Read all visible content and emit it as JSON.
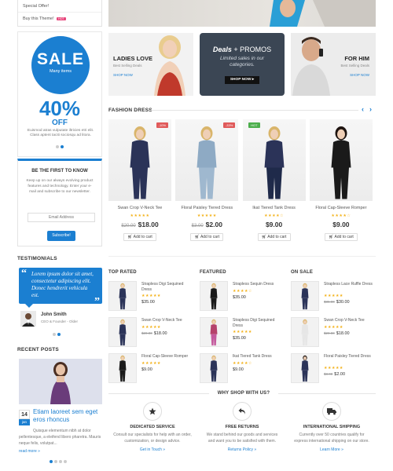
{
  "sidebar": {
    "menu": [
      {
        "label": "Special Offer!"
      },
      {
        "label": "Buy this Theme!",
        "badge": "HOT"
      }
    ],
    "sale": {
      "big": "SALE",
      "sub": "Many items",
      "percent": "40%",
      "off": "OFF",
      "text": "Euismod atras vulputate iltricies etri elit. Class aptent taciti sociosqu ad litora."
    },
    "newsletter": {
      "title": "BE THE FIRST TO KNOW",
      "text": "Keep up on our always evolving product features and technology. Enter your e-mail and subscribe to our newsletter.",
      "placeholder": "Email Address",
      "button": "Subscribe!"
    },
    "testimonials": {
      "title": "TESTIMONIALS",
      "quote": "Lorem ipsum dolor sit amet, consectetur adipiscing elit. Donec hendrerit vehicula est.",
      "name": "John Smith",
      "role": "CEO & Founder - Older"
    },
    "recent_posts": {
      "title": "RECENT POSTS",
      "day": "14",
      "month": "jan",
      "post_title": "Etiam laoreet sem eget eros rhoncus",
      "excerpt": "Quisque elementum nibh at dolor pellentesque, a eleifend libero pharetra. Mauris neque felis, volutpat...",
      "read_more": "read more »"
    }
  },
  "promos": {
    "ladies": {
      "title": "LADIES LOVE",
      "sub": "Best Selling Deals",
      "link": "SHOP NOW"
    },
    "deals": {
      "title_a": "Deals",
      "title_b": " + PROMOS",
      "text": "Limited sales in our categories.",
      "button": "SHOP NOW ▸"
    },
    "him": {
      "title": "FOR HIM",
      "sub": "Best Selling Deals",
      "link": "SHOP NOW"
    }
  },
  "fashion": {
    "title": "FASHION DRESS",
    "products": [
      {
        "name": "Swan Crop V-Neck Tee",
        "old": "$20.00",
        "price": "$18.00",
        "badge": "-10%",
        "badge_color": "#e05a5a",
        "stars": "★★★★★",
        "cart": "Add to cart"
      },
      {
        "name": "Floral Paisley Tiered Dress",
        "old": "$3.00",
        "price": "$2.00",
        "badge": "-33%",
        "badge_color": "#e05a5a",
        "stars": "★★★★★",
        "cart": "Add to cart"
      },
      {
        "name": "Ikat Tiered Tank Dress",
        "old": "",
        "price": "$9.00",
        "badge": "HOT",
        "badge_color": "#4cae4c",
        "stars": "★★★★☆",
        "cart": "Add to cart"
      },
      {
        "name": "Floral Cap-Sleeve Romper",
        "old": "",
        "price": "$9.00",
        "badge": "",
        "badge_color": "",
        "stars": "★★★★☆",
        "cart": "Add to cart"
      }
    ]
  },
  "lists": {
    "top_rated": {
      "title": "TOP RATED",
      "items": [
        {
          "name": "Strapless Digi Sequined Dress",
          "old": "",
          "price": "$35.00",
          "stars": "★★★★★"
        },
        {
          "name": "Swan Crop V-Neck Tee",
          "old": "$20.00",
          "price": "$18.00",
          "stars": "★★★★★"
        },
        {
          "name": "Floral Cap-Sleeve Romper",
          "old": "",
          "price": "$9.00",
          "stars": "★★★★★"
        }
      ]
    },
    "featured": {
      "title": "FEATURED",
      "items": [
        {
          "name": "Strapless Sequin Dress",
          "old": "",
          "price": "$35.00",
          "stars": "★★★★☆"
        },
        {
          "name": "Strapless Digi Sequined Dress",
          "old": "",
          "price": "$35.00",
          "stars": "★★★★★"
        },
        {
          "name": "Ikat Tiered Tank Dress",
          "old": "",
          "price": "$9.00",
          "stars": "★★★★☆"
        }
      ]
    },
    "on_sale": {
      "title": "ON SALE",
      "items": [
        {
          "name": "Strapless Lace Ruffle Dress",
          "old": "$35.00",
          "price": "$30.00",
          "stars": "★★★★★"
        },
        {
          "name": "Swan Crop V-Neck Tee",
          "old": "$20.00",
          "price": "$18.00",
          "stars": "★★★★★"
        },
        {
          "name": "Floral Paisley Tiered Dress",
          "old": "$3.00",
          "price": "$2.00",
          "stars": "★★★★★"
        }
      ]
    }
  },
  "why": {
    "title": "WHY SHOP WITH US?",
    "features": [
      {
        "icon": "star-icon",
        "title": "DEDICATED SERVICE",
        "text": "Consult our specialists for help with an order, customization, or design advice.",
        "link": "Get in Touch »"
      },
      {
        "icon": "return-icon",
        "title": "FREE RETURNS",
        "text": "We stand behind our goods and services and want you to be satisfied with them.",
        "link": "Returns Policy »"
      },
      {
        "icon": "truck-icon",
        "title": "INTERNATIONAL SHIPPING",
        "text": "Currently over 50 countries qualify for express international shipping on our store.",
        "link": "Learn More »"
      }
    ]
  },
  "colors": {
    "accent": "#1b7fd1",
    "dark_promo": "#3b4654",
    "hot": "#e8467c"
  }
}
